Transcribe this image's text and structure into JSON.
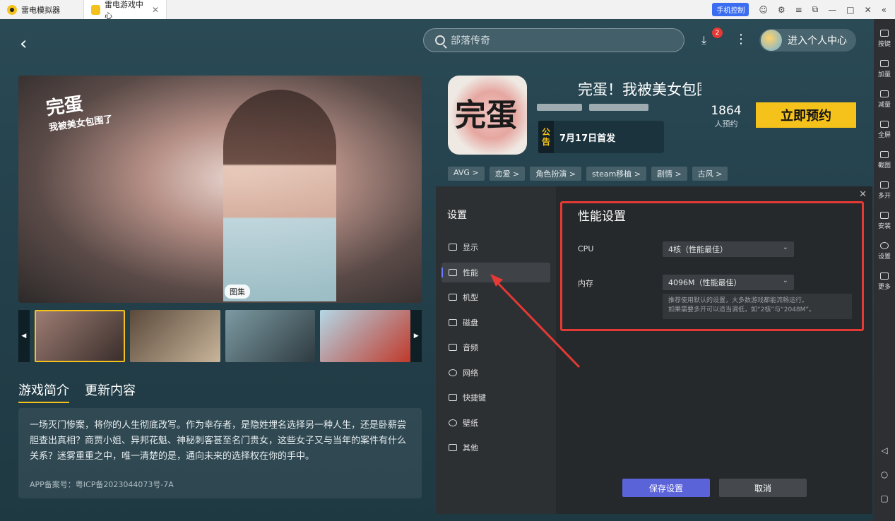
{
  "titlebar": {
    "tabs": [
      {
        "label": "雷电模拟器"
      },
      {
        "label": "雷电游戏中心"
      }
    ],
    "phone_control": "手机控制"
  },
  "rightbar": {
    "items": [
      "按键",
      "加量",
      "减量",
      "全屏",
      "截图",
      "多开",
      "安装",
      "设置",
      "更多"
    ]
  },
  "header": {
    "search_placeholder": "部落传奇",
    "download_badge": "2",
    "user_center": "进入个人中心"
  },
  "hero": {
    "logo_text": "完蛋",
    "logo_sub": "我被美女包围了",
    "gallery_label": "图集"
  },
  "intro": {
    "tabs": [
      "游戏简介",
      "更新内容"
    ],
    "text": "一场灭门惨案，将你的人生彻底改写。作为幸存者，是隐姓埋名选择另一种人生，还是卧薪尝胆查出真相？商贾小姐、异邦花魁、神秘刺客甚至名门贵女，这些女子又与当年的案件有什么关系？迷雾重重之中，唯一清楚的是，通向未来的选择权在你的手中。",
    "icp": "APP备案号：粤ICP备2023044073号-7A"
  },
  "game": {
    "icon_text": "完蛋",
    "title": "完蛋！我被美女包围了",
    "notice_tag": "公告",
    "notice_text": "7月17日首发",
    "reserve_count": "1864",
    "reserve_label": "人预约",
    "reserve_button": "立即预约",
    "tags": [
      "AVG >",
      "恋爱 >",
      "角色扮演 >",
      "steam移植 >",
      "剧情 >",
      "古风 >"
    ]
  },
  "settings": {
    "title": "设置",
    "menu": [
      "显示",
      "性能",
      "机型",
      "磁盘",
      "音频",
      "网络",
      "快捷键",
      "壁纸",
      "其他"
    ],
    "active_menu": "性能",
    "panel_title": "性能设置",
    "cpu_label": "CPU",
    "cpu_value": "4核（性能最佳）",
    "memory_label": "内存",
    "memory_value": "4096M（性能最佳）",
    "hint_line1": "推荐使用默认的设置，大多数游戏都能流畅运行。",
    "hint_line2": "如果需要多开可以适当调低，如“2核”与“2048M”。",
    "save_button": "保存设置",
    "cancel_button": "取消"
  },
  "colors": {
    "accent_yellow": "#f5c21b",
    "highlight_red": "#e53935",
    "save_blue": "#5b63d9"
  }
}
